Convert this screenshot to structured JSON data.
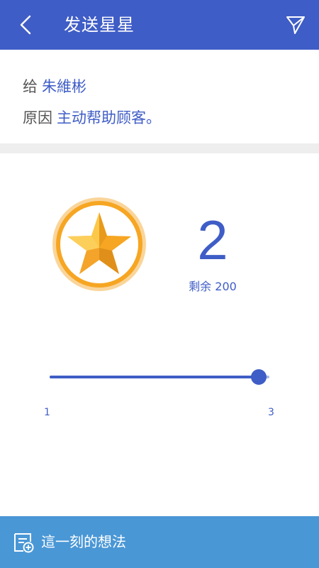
{
  "header": {
    "title": "发送星星",
    "back_icon": "chevron-left-icon",
    "send_icon": "paper-plane-icon"
  },
  "info": {
    "to_label": "给",
    "to_value": "朱維彬",
    "reason_label": "原因",
    "reason_value": "主动帮助顾客。"
  },
  "stars": {
    "badge_icon": "star-badge-icon",
    "count": "2",
    "remaining_text": "剩余 200"
  },
  "slider": {
    "min": 1,
    "max": 3,
    "value": 2.9,
    "min_label": "1",
    "max_label": "3"
  },
  "bottom_bar": {
    "label": "這一刻的想法",
    "icon": "note-add-icon"
  },
  "colors": {
    "primary": "#3F5DC6",
    "bottom_bar": "#4A97D6",
    "star_gold": "#F6A623",
    "divider": "#EEEEEE"
  }
}
